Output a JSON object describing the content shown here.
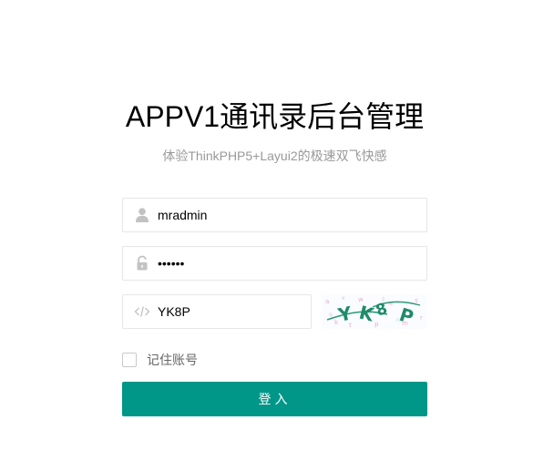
{
  "header": {
    "title": "APPV1通讯录后台管理",
    "subtitle": "体验ThinkPHP5+Layui2的极速双飞快感"
  },
  "form": {
    "username": {
      "value": "mradmin",
      "icon": "user-icon"
    },
    "password": {
      "value": "mradmi",
      "icon": "lock-icon"
    },
    "captcha": {
      "value": "YK8P",
      "icon": "code-icon",
      "image_text": "YK8P"
    },
    "remember_label": "记住账号",
    "remember_checked": false,
    "submit_label": "登入"
  },
  "colors": {
    "primary": "#009688",
    "border": "#e6e6e6",
    "icon": "#c2c2c2",
    "subtitle": "#999999"
  }
}
